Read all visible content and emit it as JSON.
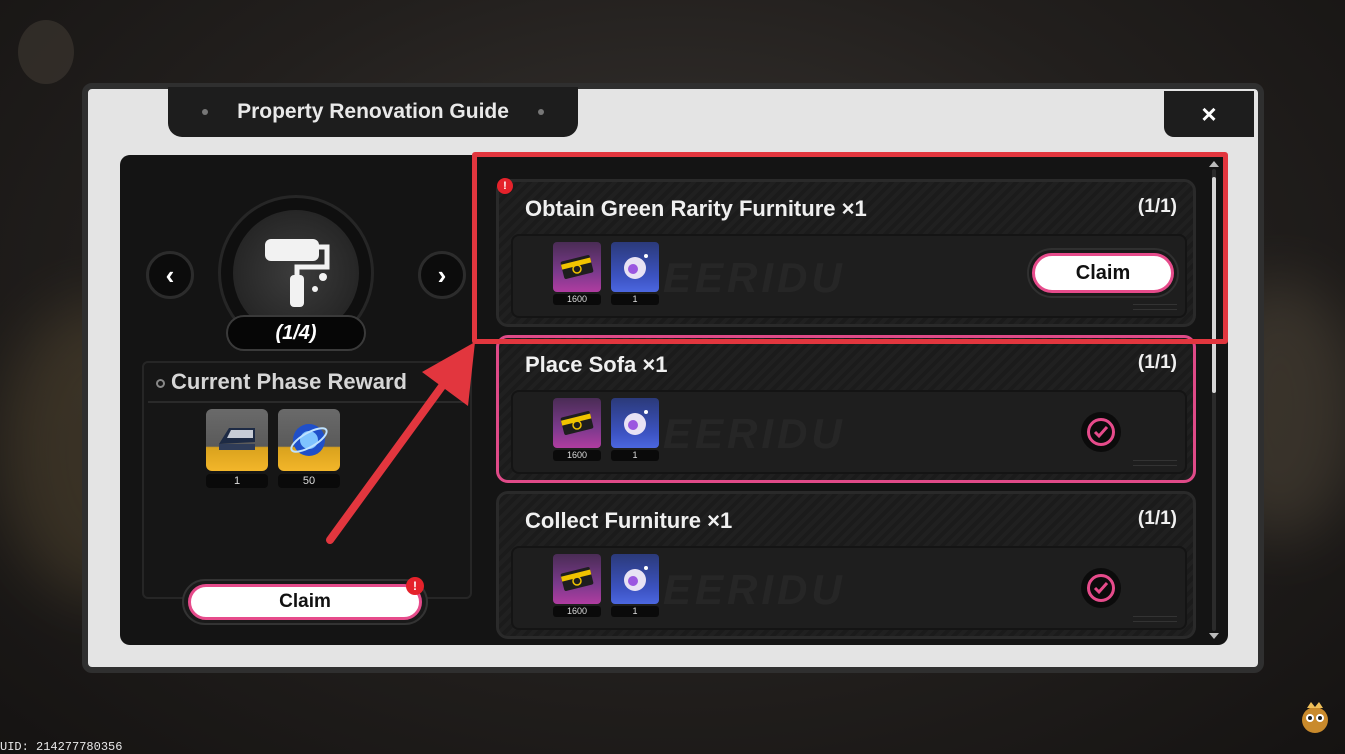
{
  "uid": "UID: 214277780356",
  "dialog": {
    "title": "Property Renovation Guide",
    "close_label": "×"
  },
  "phase": {
    "progress": "(1/4)",
    "prev_label": "‹",
    "next_label": "›",
    "emblem_icon": "paint-roller-icon",
    "reward_title": "Current Phase Reward",
    "rewards": [
      {
        "icon": "bed-icon",
        "qty": "1"
      },
      {
        "icon": "polychrome-orb-icon",
        "qty": "50"
      }
    ],
    "claim_label": "Claim"
  },
  "quests": [
    {
      "title": "Obtain Green Rarity Furniture ×1",
      "count": "(1/1)",
      "status": "claimable",
      "rewards": [
        {
          "icon": "ticket-icon",
          "qty": "1600"
        },
        {
          "icon": "creature-orb-icon",
          "qty": "1"
        }
      ],
      "action_label": "Claim"
    },
    {
      "title": "Place Sofa ×1",
      "count": "(1/1)",
      "status": "claimed",
      "rewards": [
        {
          "icon": "ticket-icon",
          "qty": "1600"
        },
        {
          "icon": "creature-orb-icon",
          "qty": "1"
        }
      ]
    },
    {
      "title": "Collect Furniture ×1",
      "count": "(1/1)",
      "status": "claimed",
      "rewards": [
        {
          "icon": "ticket-icon",
          "qty": "1600"
        },
        {
          "icon": "creature-orb-icon",
          "qty": "1"
        }
      ]
    }
  ],
  "colors": {
    "accent_pink": "#e64b8b",
    "annotation_red": "#e2363e",
    "alert_red": "#e5222b",
    "panel_dark": "#141414",
    "frame_light": "#e4e4e4"
  }
}
